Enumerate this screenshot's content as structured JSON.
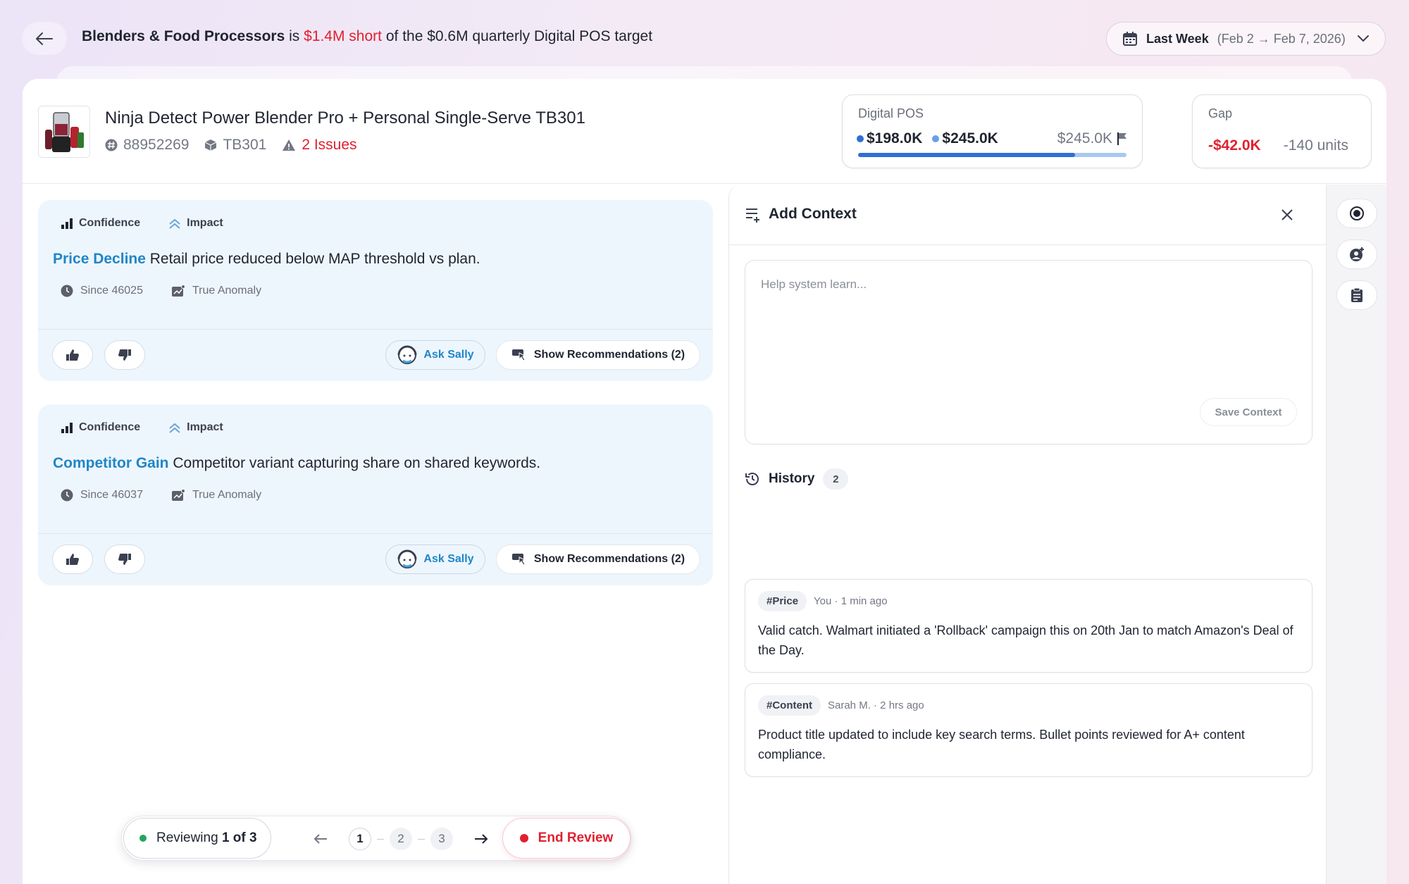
{
  "header": {
    "category": "Blenders & Food Processors",
    "connector": "is",
    "shortfall": "$1.4M short",
    "target_text": "of the $0.6M quarterly Digital POS target"
  },
  "date_picker": {
    "label": "Last Week",
    "range": "(Feb 2 → Feb 7, 2026)"
  },
  "product": {
    "title": "Ninja Detect Power Blender Pro + Personal Single-Serve TB301",
    "id": "88952269",
    "model": "TB301",
    "issues": "2 Issues"
  },
  "digital_pos": {
    "label": "Digital POS",
    "actual": "$198.0K",
    "plan": "$245.0K",
    "target": "$245.0K",
    "progress": 0.808,
    "actual_color": "#2f6fd6",
    "plan_color": "#6b9ee8"
  },
  "gap": {
    "label": "Gap",
    "value": "-$42.0K",
    "units": "-140 units"
  },
  "issues": [
    {
      "tag_confidence": "Confidence",
      "tag_impact": "Impact",
      "kind": "Price Decline",
      "description": "Retail price reduced below MAP threshold vs plan.",
      "since": "Since 46025",
      "anomaly": "True Anomaly",
      "ask_label": "Ask Sally",
      "recs_label": "Show Recommendations (2)"
    },
    {
      "tag_confidence": "Confidence",
      "tag_impact": "Impact",
      "kind": "Competitor Gain",
      "description": "Competitor variant capturing share on shared keywords.",
      "since": "Since 46037",
      "anomaly": "True Anomaly",
      "ask_label": "Ask Sally",
      "recs_label": "Show Recommendations (2)"
    }
  ],
  "context": {
    "title": "Add Context",
    "placeholder": "Help system learn...",
    "save_label": "Save Context",
    "history_title": "History",
    "history_count": "2",
    "history": [
      {
        "tag": "#Price",
        "author": "You · 1 min ago",
        "text": "Valid catch. Walmart initiated a 'Rollback' campaign this on 20th Jan to match Amazon's Deal of the Day."
      },
      {
        "tag": "#Content",
        "author": "Sarah M. · 2 hrs ago",
        "text": "Product title updated to include key search terms. Bullet points reviewed for A+ content compliance."
      }
    ]
  },
  "review": {
    "status_prefix": "Reviewing ",
    "status_value": "1 of 3",
    "pages": [
      "1",
      "2",
      "3"
    ],
    "end_label": "End Review",
    "status_color": "#22a55a",
    "end_color": "#e0202f"
  },
  "colors": {
    "accent_blue": "#1f86c8",
    "alert_red": "#e0202f"
  }
}
